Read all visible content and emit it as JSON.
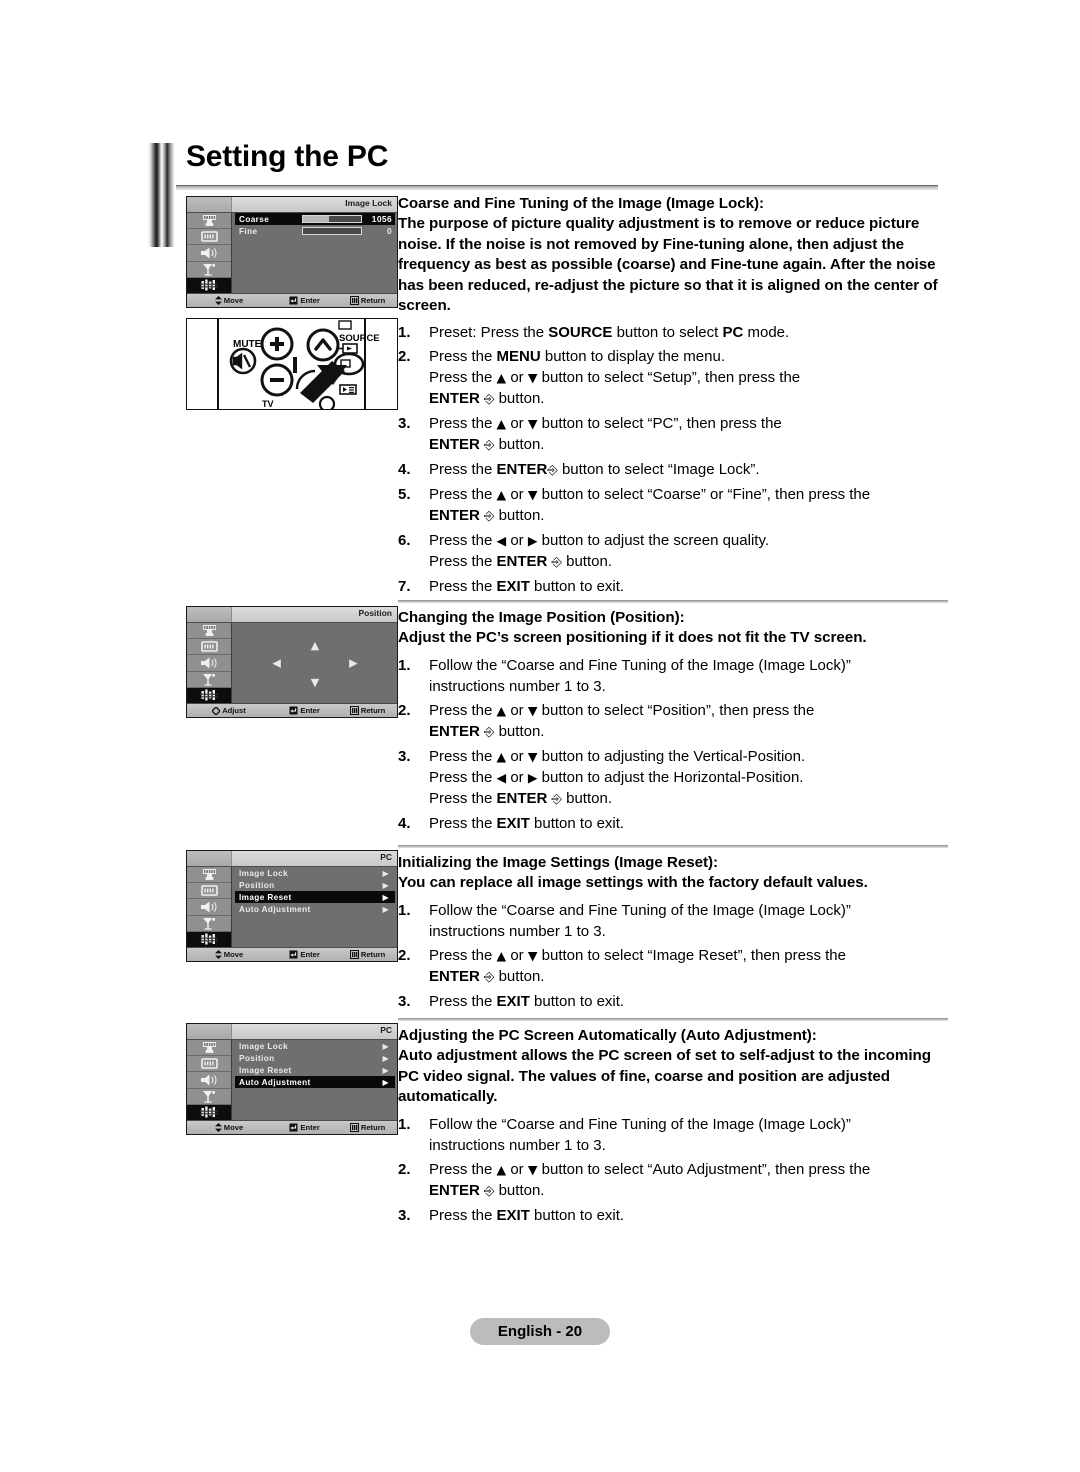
{
  "page": {
    "title": "Setting the PC",
    "footer_label": "English - 20"
  },
  "osd_common": {
    "sidebar_icons": [
      "picture-icon",
      "display-icon",
      "sound-icon",
      "channel-icon",
      "setup-icon"
    ],
    "bottom": {
      "move": "Move",
      "adjust": "Adjust",
      "enter": "Enter",
      "return": "Return"
    }
  },
  "figures": {
    "image_lock": {
      "title": "Image Lock",
      "rows": [
        {
          "label": "Coarse",
          "value": "1056",
          "fill_pct": 45,
          "highlighted": true
        },
        {
          "label": "Fine",
          "value": "0",
          "fill_pct": 0,
          "highlighted": false
        }
      ],
      "bottom_left": "Move"
    },
    "remote": {
      "mute_label": "MUTE",
      "source_label": "SOURCE",
      "tv_label": "TV",
      "plus_label": "+",
      "minus_label": "−"
    },
    "position": {
      "title": "Position",
      "bottom_left": "Adjust",
      "arrows": [
        "up-arrow-icon",
        "down-arrow-icon",
        "left-arrow-icon",
        "right-arrow-icon"
      ]
    },
    "image_reset": {
      "title": "PC",
      "items": [
        {
          "label": "Image Lock",
          "highlighted": false
        },
        {
          "label": "Position",
          "highlighted": false
        },
        {
          "label": "Image Reset",
          "highlighted": true
        },
        {
          "label": "Auto Adjustment",
          "highlighted": false
        }
      ],
      "bottom_left": "Move"
    },
    "auto_adjustment": {
      "title": "PC",
      "items": [
        {
          "label": "Image Lock",
          "highlighted": false
        },
        {
          "label": "Position",
          "highlighted": false
        },
        {
          "label": "Image Reset",
          "highlighted": false
        },
        {
          "label": "Auto Adjustment",
          "highlighted": true
        }
      ],
      "bottom_left": "Move"
    }
  },
  "sections": [
    {
      "heading_line1": "Coarse and Fine Tuning of the Image (Image Lock):",
      "heading_line2": "The purpose of picture quality adjustment is to remove or reduce picture noise. If the noise is not removed by Fine-tuning alone, then adjust the frequency as best as possible (coarse) and Fine-tune again. After the noise has been reduced, re-adjust the picture so that it is aligned on the center of screen.",
      "steps": [
        {
          "n": "1.",
          "main_pre": "Preset: Press the ",
          "main_bold": "SOURCE",
          "main_post": " button to select ",
          "main_bold2": "PC",
          "main_post2": " mode."
        },
        {
          "n": "2.",
          "main_pre": "Press the ",
          "main_bold": "MENU",
          "main_post": " button to display the menu.",
          "sub_pre": "Press the ▲ or ▼ button to select “Setup”, then press the ",
          "sub_bold": "ENTER",
          "sub_post": " button."
        },
        {
          "n": "3.",
          "main_pre": "Press the ▲ or ▼ button to select “PC”, then press the ",
          "sub_bold": "ENTER",
          "sub_post": " button."
        },
        {
          "n": "4.",
          "main_pre": "Press the ",
          "main_bold": "ENTER",
          "main_post": " button to select “Image Lock”."
        },
        {
          "n": "5.",
          "main_pre": "Press the ▲ or ▼ button to select “Coarse” or “Fine”, then press the ",
          "sub_bold": "ENTER",
          "sub_post": " button."
        },
        {
          "n": "6.",
          "main_pre": "Press the ◀ or ▶ button to adjust the screen quality.",
          "sub_pre": "Press the ",
          "sub_bold": "ENTER",
          "sub_post": " button."
        },
        {
          "n": "7.",
          "main_pre": "Press the ",
          "main_bold": "EXIT",
          "main_post": " button to exit."
        }
      ]
    },
    {
      "heading_line1": "Changing the Image Position (Position):",
      "heading_line2": "Adjust the PC’s screen positioning if it does not fit the TV screen.",
      "steps": [
        {
          "n": "1.",
          "main_pre": "Follow the “Coarse and Fine Tuning of the Image (Image Lock)”",
          "sub_pre": "instructions number 1 to 3."
        },
        {
          "n": "2.",
          "main_pre": "Press the ▲ or ▼ button to select “Position”, then press the ",
          "sub_bold": "ENTER",
          "sub_post": " button."
        },
        {
          "n": "3.",
          "main_pre": "Press the ▲ or ▼ button to adjusting the Vertical-Position.",
          "sub_pre": "Press the ◀ or ▶ button to adjust the Horizontal-Position.",
          "sub2_pre": "Press the ",
          "sub_bold": "ENTER",
          "sub_post": " button."
        },
        {
          "n": "4.",
          "main_pre": "Press the ",
          "main_bold": "EXIT",
          "main_post": " button to exit."
        }
      ]
    },
    {
      "heading_line1": "Initializing the Image Settings (Image Reset):",
      "heading_line2": "You can replace all image settings with the factory default values.",
      "steps": [
        {
          "n": "1.",
          "main_pre": "Follow the “Coarse and Fine Tuning of the Image (Image Lock)”",
          "sub_pre": "instructions number 1 to 3."
        },
        {
          "n": "2.",
          "main_pre": "Press the ▲ or ▼ button to select “Image Reset”, then press the ",
          "sub_bold": "ENTER",
          "sub_post": " button."
        },
        {
          "n": "3.",
          "main_pre": "Press the ",
          "main_bold": "EXIT",
          "main_post": " button to exit."
        }
      ]
    },
    {
      "heading_line1": "Adjusting the PC Screen Automatically (Auto Adjustment):",
      "heading_line2": "Auto adjustment allows the PC screen of set to self-adjust to the incoming PC video signal. The values of fine, coarse and position are adjusted automatically.",
      "steps": [
        {
          "n": "1.",
          "main_pre": "Follow the “Coarse and Fine Tuning of the Image (Image Lock)”",
          "sub_pre": "instructions number 1 to 3."
        },
        {
          "n": "2.",
          "main_pre": "Press the ▲ or ▼ button to select “Auto Adjustment”, then press the ",
          "sub_bold": "ENTER",
          "sub_post": " button."
        },
        {
          "n": "3.",
          "main_pre": "Press the ",
          "main_bold": "EXIT",
          "main_post": " button to exit."
        }
      ]
    }
  ]
}
